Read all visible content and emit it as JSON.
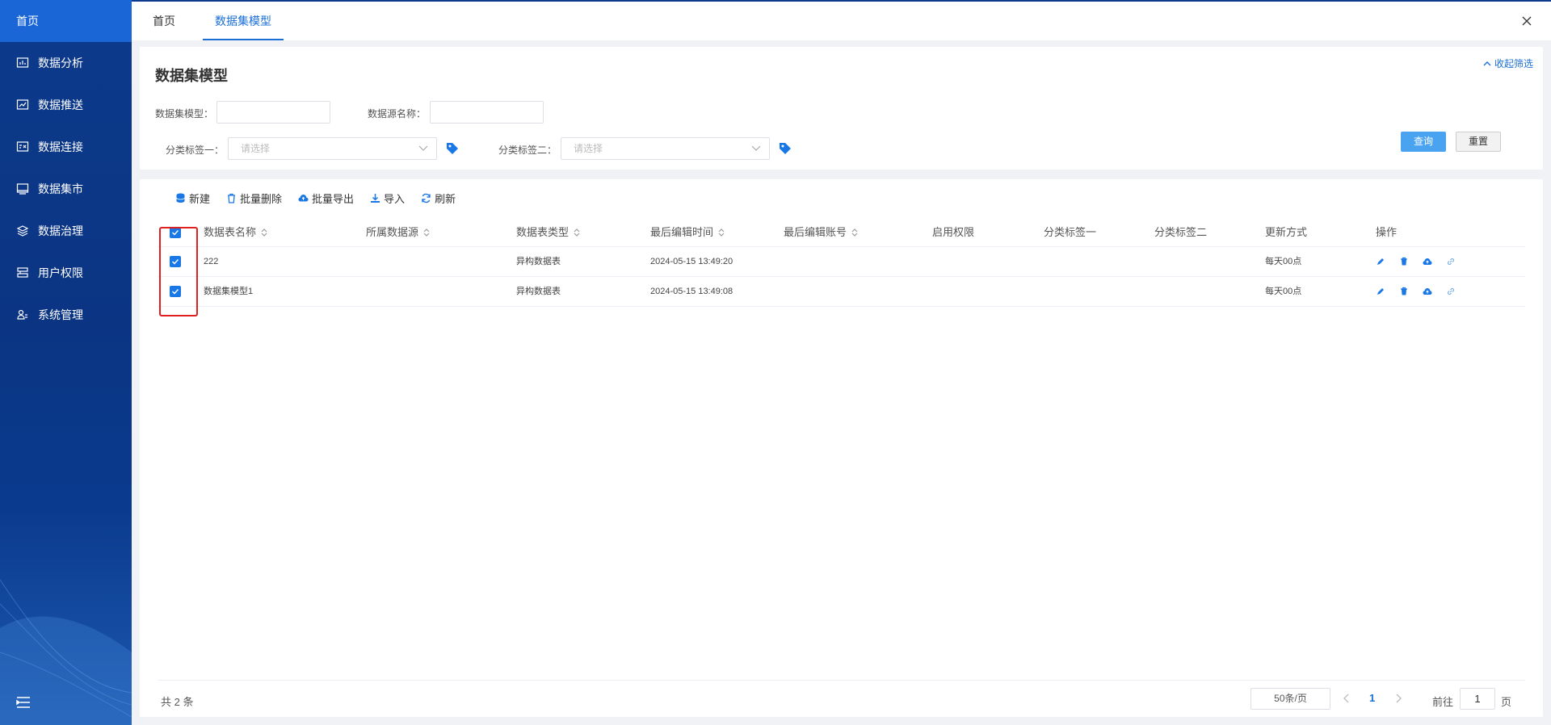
{
  "sidebar": {
    "home": "首页",
    "items": [
      {
        "label": "数据分析",
        "icon": "analysis-icon"
      },
      {
        "label": "数据推送",
        "icon": "push-icon"
      },
      {
        "label": "数据连接",
        "icon": "connect-icon"
      },
      {
        "label": "数据集市",
        "icon": "market-icon"
      },
      {
        "label": "数据治理",
        "icon": "layers-icon"
      },
      {
        "label": "用户权限",
        "icon": "permission-icon"
      },
      {
        "label": "系统管理",
        "icon": "system-icon"
      }
    ]
  },
  "tabs": [
    {
      "label": "首页"
    },
    {
      "label": "数据集模型"
    }
  ],
  "filter": {
    "title": "数据集模型",
    "fold": "收起筛选",
    "dataset_model_label": "数据集模型：",
    "datasource_label": "数据源名称：",
    "tag1_label": "分类标签一：",
    "tag2_label": "分类标签二：",
    "tag1_placeholder": "请选择",
    "tag2_placeholder": "请选择",
    "query": "查询",
    "reset": "重置"
  },
  "toolbar": {
    "new": "新建",
    "batch_delete": "批量删除",
    "batch_export": "批量导出",
    "import": "导入",
    "refresh": "刷新"
  },
  "table": {
    "columns": [
      "数据表名称",
      "所属数据源",
      "数据表类型",
      "最后编辑时间",
      "最后编辑账号",
      "启用权限",
      "分类标签一",
      "分类标签二",
      "更新方式",
      "操作"
    ],
    "rows": [
      {
        "name": "222",
        "source": "",
        "type": "异构数据表",
        "edited": "2024-05-15 13:49:20",
        "account": "",
        "perm": "",
        "tag1": "",
        "tag2": "",
        "update": "每天00点"
      },
      {
        "name": "数据集模型1",
        "source": "",
        "type": "异构数据表",
        "edited": "2024-05-15 13:49:08",
        "account": "",
        "perm": "",
        "tag1": "",
        "tag2": "",
        "update": "每天00点"
      }
    ]
  },
  "footer": {
    "total": "共 2 条",
    "page_size": "50条/页",
    "current_page": "1",
    "goto": "前往",
    "goto_value": "1",
    "page_unit": "页"
  },
  "colors": {
    "sidebar": "#0d3a8c",
    "accent": "#1a6fd6",
    "query_button": "#4aa3f0",
    "highlight": "#e02020"
  }
}
